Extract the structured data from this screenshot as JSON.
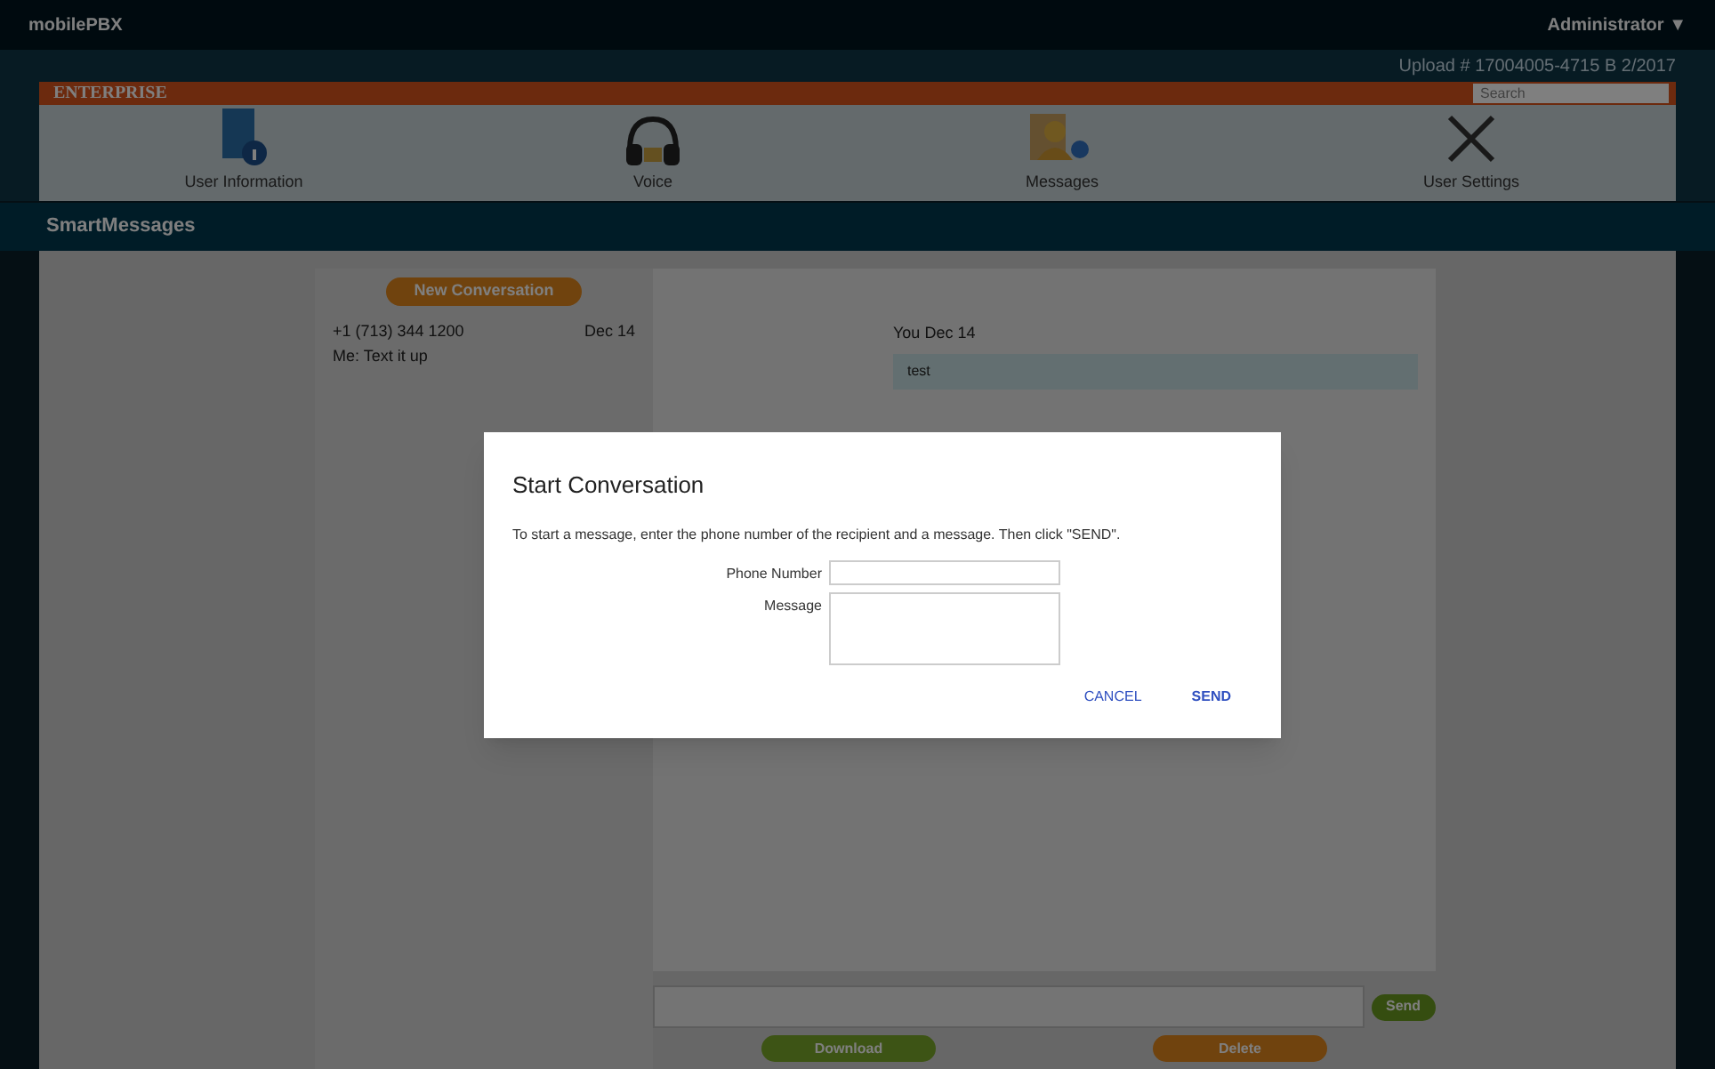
{
  "top_bar": {
    "brand": "mobilePBX",
    "user_menu": "Administrator ▼"
  },
  "header": {
    "account_line": "Upload # 17004005-4715 B 2/2017",
    "logo": "ENTERPRISE",
    "search": {
      "placeholder": "Search"
    }
  },
  "nav": [
    {
      "kind": "info",
      "label": "User Information"
    },
    {
      "kind": "voice",
      "label": "Voice"
    },
    {
      "kind": "messages",
      "label": "Messages"
    },
    {
      "kind": "settings",
      "label": "User Settings"
    }
  ],
  "page_title": "SmartMessages",
  "conversations": {
    "new_button": "New Conversation",
    "items": [
      {
        "number": "+1 (713) 344 1200",
        "date": "Dec 14",
        "preview": "Me: Text it up"
      }
    ]
  },
  "thread": {
    "messages": [
      {
        "meta": "You Dec 14",
        "text": "test"
      }
    ],
    "send_button": "Send"
  },
  "actions": [
    {
      "kind": "green",
      "label": "Download"
    },
    {
      "kind": "orange",
      "label": "Delete"
    }
  ],
  "dialog": {
    "title": "Start Conversation",
    "instructions": "To start a message, enter the phone number of the recipient and a message. Then click \"SEND\".",
    "fields": [
      {
        "kind": "line",
        "label": "Phone Number"
      },
      {
        "kind": "area",
        "label": "Message"
      }
    ],
    "buttons": [
      "CANCEL",
      "SEND"
    ]
  }
}
